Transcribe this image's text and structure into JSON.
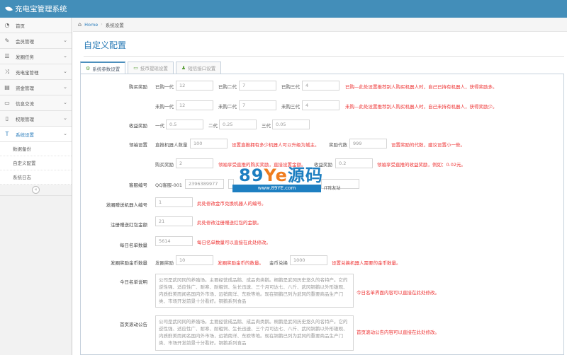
{
  "app": {
    "title": "充电宝管理系统"
  },
  "sidebar": {
    "items": [
      {
        "label": "首页",
        "icon": "dashboard-icon"
      },
      {
        "label": "会员管理",
        "icon": "edit-icon"
      },
      {
        "label": "发圈任务",
        "icon": "list-icon"
      },
      {
        "label": "充电宝管理",
        "icon": "shuffle-icon"
      },
      {
        "label": "资金管理",
        "icon": "money-icon"
      },
      {
        "label": "信息交流",
        "icon": "comment-icon"
      },
      {
        "label": "权限管理",
        "icon": "file-icon"
      },
      {
        "label": "系统设置",
        "icon": "text-width-icon"
      }
    ],
    "subitems": [
      "数据备份",
      "自定义配置",
      "系统日志"
    ]
  },
  "breadcrumb": {
    "home": "Home",
    "current": "系统设置"
  },
  "page": {
    "title": "自定义配置"
  },
  "tabs": [
    {
      "label": "系统参数设置"
    },
    {
      "label": "技币提现设置"
    },
    {
      "label": "短信接口设置"
    }
  ],
  "form": {
    "buy_reward": {
      "label": "购买奖励",
      "row1": {
        "f1_label": "已购一代",
        "f1_value": "12",
        "f2_label": "已购二代",
        "f2_value": "7",
        "f3_label": "已购三代",
        "f3_value": "4",
        "note": "已购—此处设置推荐别人购买机器人时，自己已持有机器人，获得奖励多。"
      },
      "row2": {
        "f1_label": "未购一代",
        "f1_value": "12",
        "f2_label": "未购二代",
        "f2_value": "7",
        "f3_label": "未购三代",
        "f3_value": "4",
        "note": "未购—此处设置推荐别人购买机器人时，自己未持有机器人，获得奖励少。"
      }
    },
    "income_reward": {
      "label": "收益奖励",
      "f1_label": "一代",
      "f1_value": "0.5",
      "f2_label": "二代",
      "f2_value": "0.25",
      "f3_label": "三代",
      "f3_value": "0.05"
    },
    "leader_reward": {
      "label": "领袖设置",
      "row1": {
        "f1_label": "直推机器人数量",
        "f1_value": "100",
        "note1": "设置直推拥有多少机器人可以升级为城主。",
        "f2_label": "奖励代数",
        "f2_value": "999",
        "note2": "设置奖励的代数，建议设置小一些。"
      },
      "row2": {
        "f1_label": "购买奖励",
        "f1_value": "2",
        "note1": "领袖享受直推的购买奖励，直接设置金额。",
        "f2_label": "收益奖励",
        "f2_value": "0.2",
        "note2": "领袖享受直推的收益奖励，例如：0.02元。"
      }
    },
    "service": {
      "label": "客服编号",
      "f1_label": "QQ客服-001",
      "f1_value": "2396389977"
    },
    "robot_id": {
      "label": "发圈赠送机器人编号",
      "value": "1",
      "note": "此处修改金币兑换机器人的编号。"
    },
    "register_gift": {
      "label": "注册赠送红包金额",
      "value": "21",
      "note": "此处修改注册赠送红包的金额。"
    },
    "daily_count": {
      "label": "每日名单数量",
      "value": "5614",
      "note": "每日名单数量可以直接在此处修改。"
    },
    "circle_reward": {
      "label": "发圈奖励金币数量",
      "f1_label": "发圈奖励",
      "f1_value": "10",
      "note1": "发圈奖励金币的数量。",
      "f2_label": "金币兑换",
      "f2_value": "1000",
      "note2": "设置兑换机器人需要的金币数量。"
    },
    "today_desc": {
      "label": "今日名单说明",
      "text": "公司是武冈冈的养殖场。主要经营成品鹅、成品肉类鹅。桐鹅是武冈历史悠久的名特产。它的逆性强、适应性广、耐寒、耐粗饲、生长迅速、三个月可达七、八斤、武冈铜鹅以外形雄观、内质鲜美而闻名国内外市场，远销南洋、东欧等地。现在铜鹅已列为武冈的重要商品生产门类、市场开发前景十分看好。铜鹅系列食品",
      "note": "今日名单界面内容可以直接在此处修改。"
    },
    "scroll_notice": {
      "label": "首页滚动公告",
      "text": "公司是武冈冈的养殖场。主要经营成品鹅、成品肉类鹅。桐鹅是武冈历史悠久的名特产。它的逆性强、适应性广、耐寒、耐粗饲、生长迅速、三个月可达七、八斤、武冈铜鹅以外形雄观、内质鲜美而闻名国内外市场，远销南洋、东欧等地。现在铜鹅已列为武冈的重要商品生产门类、市场开发前景十分看好。铜鹅系列食品",
      "note": "首页滚动公告内容可以直接在此处修改。"
    }
  },
  "watermark": {
    "brand_a": "89",
    "brand_b": "Ye",
    "brand_c": "源码",
    "url": "www.89YE.com",
    "tag": "IT阵友站"
  },
  "colors": {
    "topbar": "#438eb9",
    "accent": "#2b7dbc",
    "note": "#ee3333"
  }
}
